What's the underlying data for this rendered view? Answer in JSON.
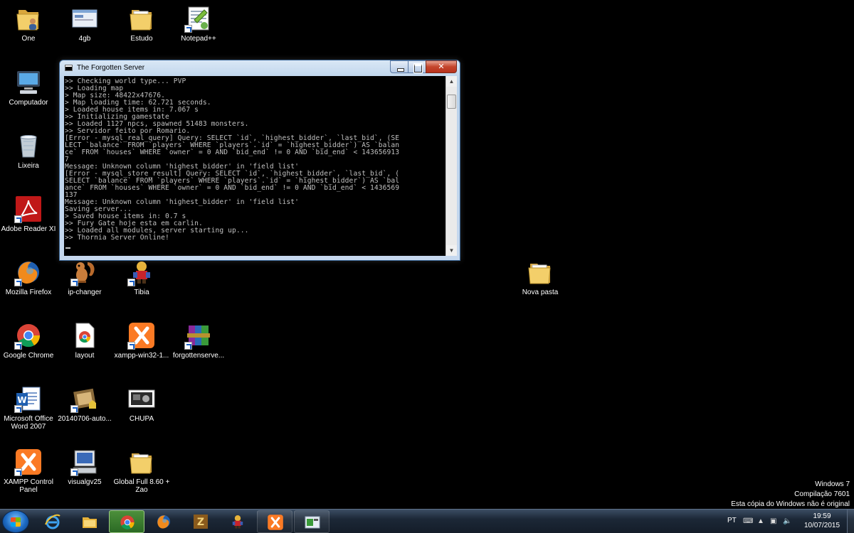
{
  "desktop_icons": [
    {
      "name": "icon-one",
      "label": "One",
      "label2": "",
      "kind": "folder-user"
    },
    {
      "name": "icon-4gb",
      "label": "4gb",
      "label2": "",
      "kind": "window-file"
    },
    {
      "name": "icon-estudo",
      "label": "Estudo",
      "label2": "",
      "kind": "folder"
    },
    {
      "name": "icon-notepadpp",
      "label": "Notepad++",
      "label2": "",
      "kind": "notepad"
    },
    {
      "name": "icon-computador",
      "label": "Computador",
      "label2": "",
      "kind": "computer"
    },
    {
      "name": "icon-lixeira",
      "label": "Lixeira",
      "label2": "",
      "kind": "recycle-bin"
    },
    {
      "name": "icon-adobe-reader",
      "label": "Adobe Reader XI",
      "label2": "",
      "kind": "adobe"
    },
    {
      "name": "icon-firefox",
      "label": "Mozilla Firefox",
      "label2": "",
      "kind": "firefox"
    },
    {
      "name": "icon-ip-changer",
      "label": "ip-changer",
      "label2": "",
      "kind": "squirrel"
    },
    {
      "name": "icon-tibia",
      "label": "Tibia",
      "label2": "",
      "kind": "tibia"
    },
    {
      "name": "icon-nova-pasta",
      "label": "Nova pasta",
      "label2": "",
      "kind": "folder"
    },
    {
      "name": "icon-google-chrome",
      "label": "Google Chrome",
      "label2": "",
      "kind": "chrome"
    },
    {
      "name": "icon-layout",
      "label": "layout",
      "label2": "",
      "kind": "chrome-doc"
    },
    {
      "name": "icon-xampp-win32",
      "label": "xampp-win32-1...",
      "label2": "",
      "kind": "xampp"
    },
    {
      "name": "icon-forgottenserver",
      "label": "forgottenserve...",
      "label2": "",
      "kind": "winrar"
    },
    {
      "name": "icon-word-2007",
      "label": "Microsoft Office",
      "label2": "Word 2007",
      "kind": "word"
    },
    {
      "name": "icon-20140706",
      "label": "20140706-auto...",
      "label2": "",
      "kind": "installer"
    },
    {
      "name": "icon-chupa",
      "label": "CHUPA",
      "label2": "",
      "kind": "image"
    },
    {
      "name": "icon-xampp-control",
      "label": "XAMPP Control",
      "label2": "Panel",
      "kind": "xampp"
    },
    {
      "name": "icon-visualgv25",
      "label": "visualgv25",
      "label2": "",
      "kind": "pc"
    },
    {
      "name": "icon-global-full",
      "label": "Global Full 8.60 +",
      "label2": "Zao",
      "kind": "folder"
    }
  ],
  "window": {
    "title": "The Forgotten Server",
    "console_lines": [
      ">> Checking world type... PVP",
      ">> Loading map",
      "> Map size: 48422x47676.",
      "> Map loading time: 62.721 seconds.",
      "> Loaded house items in: 7.067 s",
      ">> Initializing gamestate",
      ">> Loaded 1127 npcs, spawned 51483 monsters.",
      ">> Servidor feito por Romario.",
      "[Error - mysql_real_query] Query: SELECT `id`, `highest_bidder`, `last_bid`, (SE",
      "LECT `balance` FROM `players` WHERE `players`.`id` = `highest_bidder`) AS `balan",
      "ce` FROM `houses` WHERE `owner` = 0 AND `bid_end` != 0 AND `bid_end` < 143656913",
      "7",
      "Message: Unknown column 'highest_bidder' in 'field list'",
      "[Error - mysql_store_result] Query: SELECT `id`, `highest_bidder`, `last_bid`, (",
      "SELECT `balance` FROM `players` WHERE `players`.`id` = `highest_bidder`) AS `bal",
      "ance` FROM `houses` WHERE `owner` = 0 AND `bid_end` != 0 AND `bid_end` < 1436569",
      "137",
      "Message: Unknown column 'highest_bidder' in 'field list'",
      "Saving server...",
      "> Saved house items in: 0.7 s",
      ">> Fury Gate hoje esta em carlin.",
      ">> Loaded all modules, server starting up...",
      ">> Thornia Server Online!"
    ]
  },
  "watermark": {
    "line1": "Windows 7",
    "line2": "Compilação 7601",
    "line3": "Esta cópia do Windows não é original"
  },
  "taskbar": {
    "pinned": [
      {
        "name": "taskbar-ie",
        "kind": "ie"
      },
      {
        "name": "taskbar-explorer",
        "kind": "explorer"
      },
      {
        "name": "taskbar-chrome",
        "kind": "chrome"
      },
      {
        "name": "taskbar-firefox",
        "kind": "firefox"
      },
      {
        "name": "taskbar-winrar",
        "kind": "winrar-z"
      },
      {
        "name": "taskbar-tibia",
        "kind": "tibia"
      },
      {
        "name": "taskbar-xampp",
        "kind": "xampp"
      },
      {
        "name": "taskbar-console",
        "kind": "console"
      }
    ],
    "active_index": 2,
    "language": "PT",
    "clock_time": "19:59",
    "clock_date": "10/07/2015"
  }
}
